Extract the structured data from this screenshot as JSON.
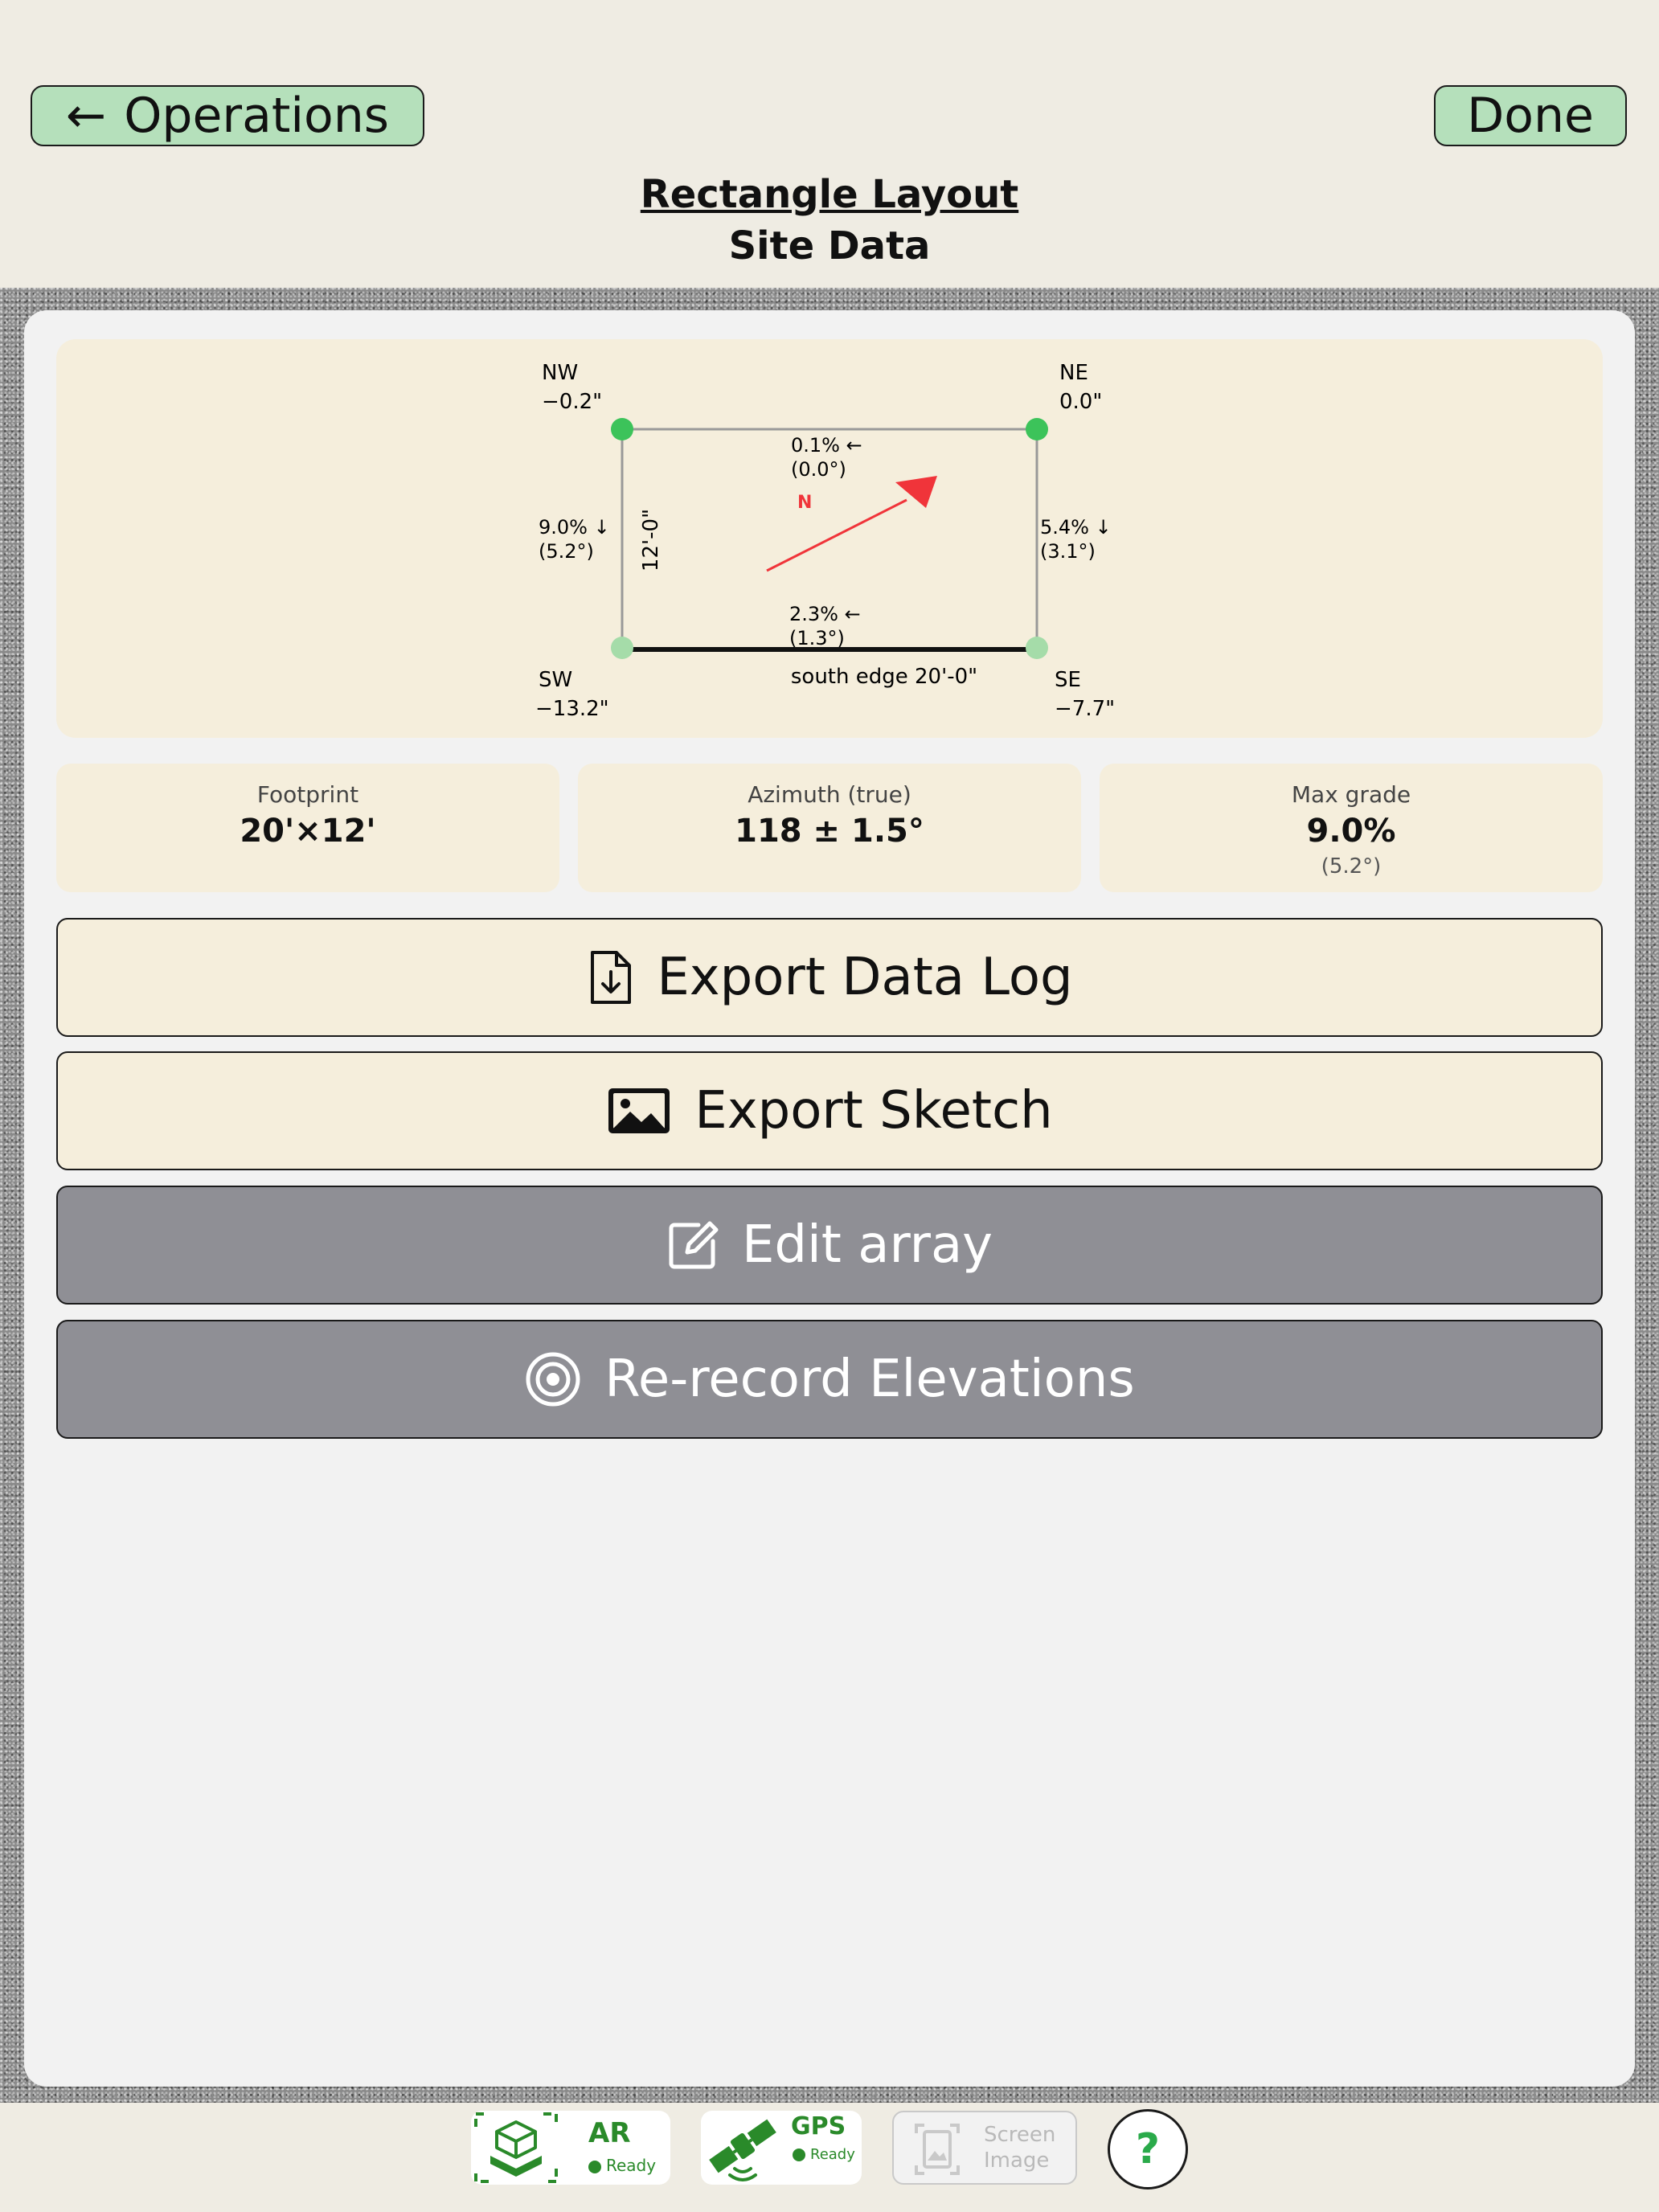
{
  "header": {
    "back_label": "Operations",
    "done_label": "Done",
    "title": "Rectangle Layout",
    "subtitle": "Site Data"
  },
  "sketch": {
    "corners": {
      "nw": {
        "name": "NW",
        "value": "−0.2\""
      },
      "ne": {
        "name": "NE",
        "value": "0.0\""
      },
      "sw": {
        "name": "SW",
        "value": "−13.2\""
      },
      "se": {
        "name": "SE",
        "value": "−7.7\""
      }
    },
    "edges": {
      "north": {
        "grade": "0.1% ←",
        "angle": "(0.0°)"
      },
      "west": {
        "grade": "9.0% ↓",
        "angle": "(5.2°)"
      },
      "east": {
        "grade": "5.4% ↓",
        "angle": "(3.1°)"
      },
      "south": {
        "grade": "2.3% ←",
        "angle": "(1.3°)"
      }
    },
    "west_length": "12'-0\"",
    "south_edge_label": "south edge 20'-0\"",
    "north_label": "N"
  },
  "stats": [
    {
      "label": "Footprint",
      "value": "20'×12'",
      "sub": ""
    },
    {
      "label": "Azimuth (true)",
      "value": "118 ± 1.5°",
      "sub": ""
    },
    {
      "label": "Max grade",
      "value": "9.0%",
      "sub": "(5.2°)"
    }
  ],
  "actions": {
    "export_log": "Export Data Log",
    "export_sketch": "Export Sketch",
    "edit_array": "Edit array",
    "rerecord": "Re-record Elevations"
  },
  "footer": {
    "ar_label": "AR",
    "ar_status": "Ready",
    "gps_label": "GPS",
    "gps_status": "Ready",
    "screen_line1": "Screen",
    "screen_line2": "Image",
    "help_label": "?"
  },
  "colors": {
    "accent_green": "#b5e0bb",
    "corner_green": "#3cc35a",
    "corner_light_green": "#a5dca9",
    "arrow_red": "#f0343a",
    "card_bg": "#f5eedc",
    "dark_button": "#8f8f95"
  }
}
